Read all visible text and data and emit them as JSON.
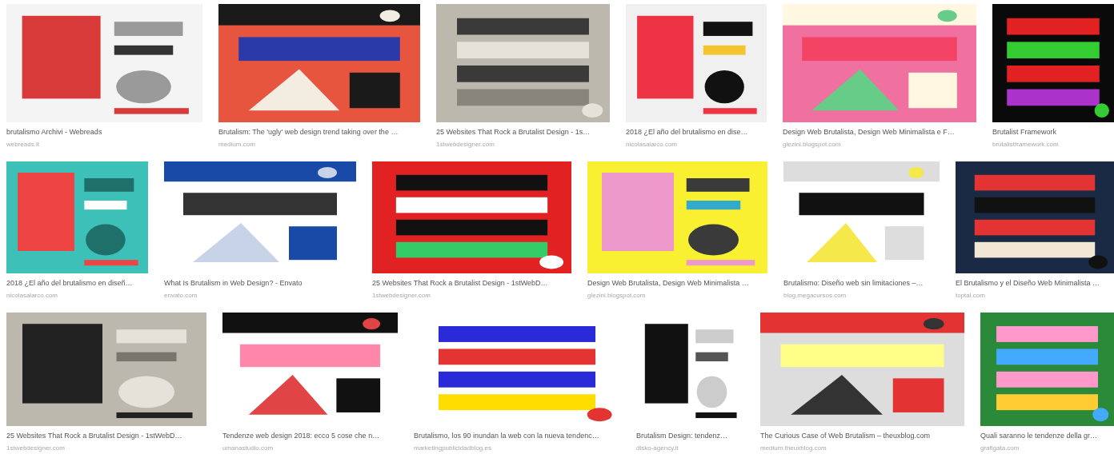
{
  "results": [
    {
      "items": [
        {
          "caption": "brutalismo Archivi - Webreads",
          "source": "webreads.it"
        },
        {
          "caption": "Brutalism: The 'ugly' web design trend taking over the …",
          "source": "medium.com"
        },
        {
          "caption": "25 Websites That Rock a Brutalist Design - 1s…",
          "source": "1stwebdesigner.com"
        },
        {
          "caption": "2018 ¿El año del brutalismo en dise…",
          "source": "nicolasalarco.com"
        },
        {
          "caption": "Design Web Brutalista, Design Web Minimalista e F…",
          "source": "glezini.blogspot.com"
        },
        {
          "caption": "Brutalist Framework",
          "source": "brutalistframework.com"
        }
      ]
    },
    {
      "items": [
        {
          "caption": "2018 ¿El año del brutalismo en diseñ…",
          "source": "nicolasalarco.com"
        },
        {
          "caption": "What Is Brutalism in Web Design? - Envato",
          "source": "envato.com"
        },
        {
          "caption": "25 Websites That Rock a Brutalist Design - 1stWebD…",
          "source": "1stwebdesigner.com"
        },
        {
          "caption": "Design Web Brutalista, Design Web Minimalista …",
          "source": "glezini.blogspot.com"
        },
        {
          "caption": "Brutalismo: Diseño web sin limitaciones –…",
          "source": "blog.megacursos.com"
        },
        {
          "caption": "El Brutalismo y el Diseño Web Minimalista …",
          "source": "toptal.com"
        }
      ]
    },
    {
      "items": [
        {
          "caption": "25 Websites That Rock a Brutalist Design - 1stWebD…",
          "source": "1stwebdesigner.com"
        },
        {
          "caption": "Tendenze web design 2018: ecco 5 cose che n…",
          "source": "umanastudio.com"
        },
        {
          "caption": "Brutalismo, los 90 inundan la web con la nueva tendenc…",
          "source": "marketingpublicidadblog.es"
        },
        {
          "caption": "Brutalism Design: tendenz…",
          "source": "disko-agency.it"
        },
        {
          "caption": "The Curious Case of Web Brutalism – theuxblog.com",
          "source": "medium.theuxblog.com"
        },
        {
          "caption": "Quali saranno le tendenze della gr…",
          "source": "grafigata.com"
        }
      ]
    }
  ]
}
